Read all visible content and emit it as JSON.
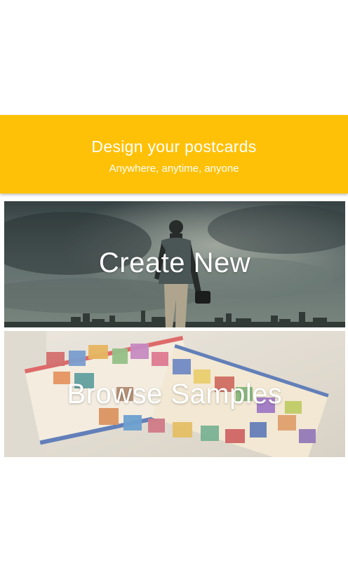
{
  "header": {
    "title": "Design your postcards",
    "subtitle": "Anywhere, anytime, anyone"
  },
  "tiles": [
    {
      "label": "Create New",
      "image": "traveler-skyline-photo"
    },
    {
      "label": "Browse Samples",
      "image": "postage-stamps-photo"
    }
  ],
  "colors": {
    "banner": "#ffc107",
    "text": "#ffffff"
  }
}
